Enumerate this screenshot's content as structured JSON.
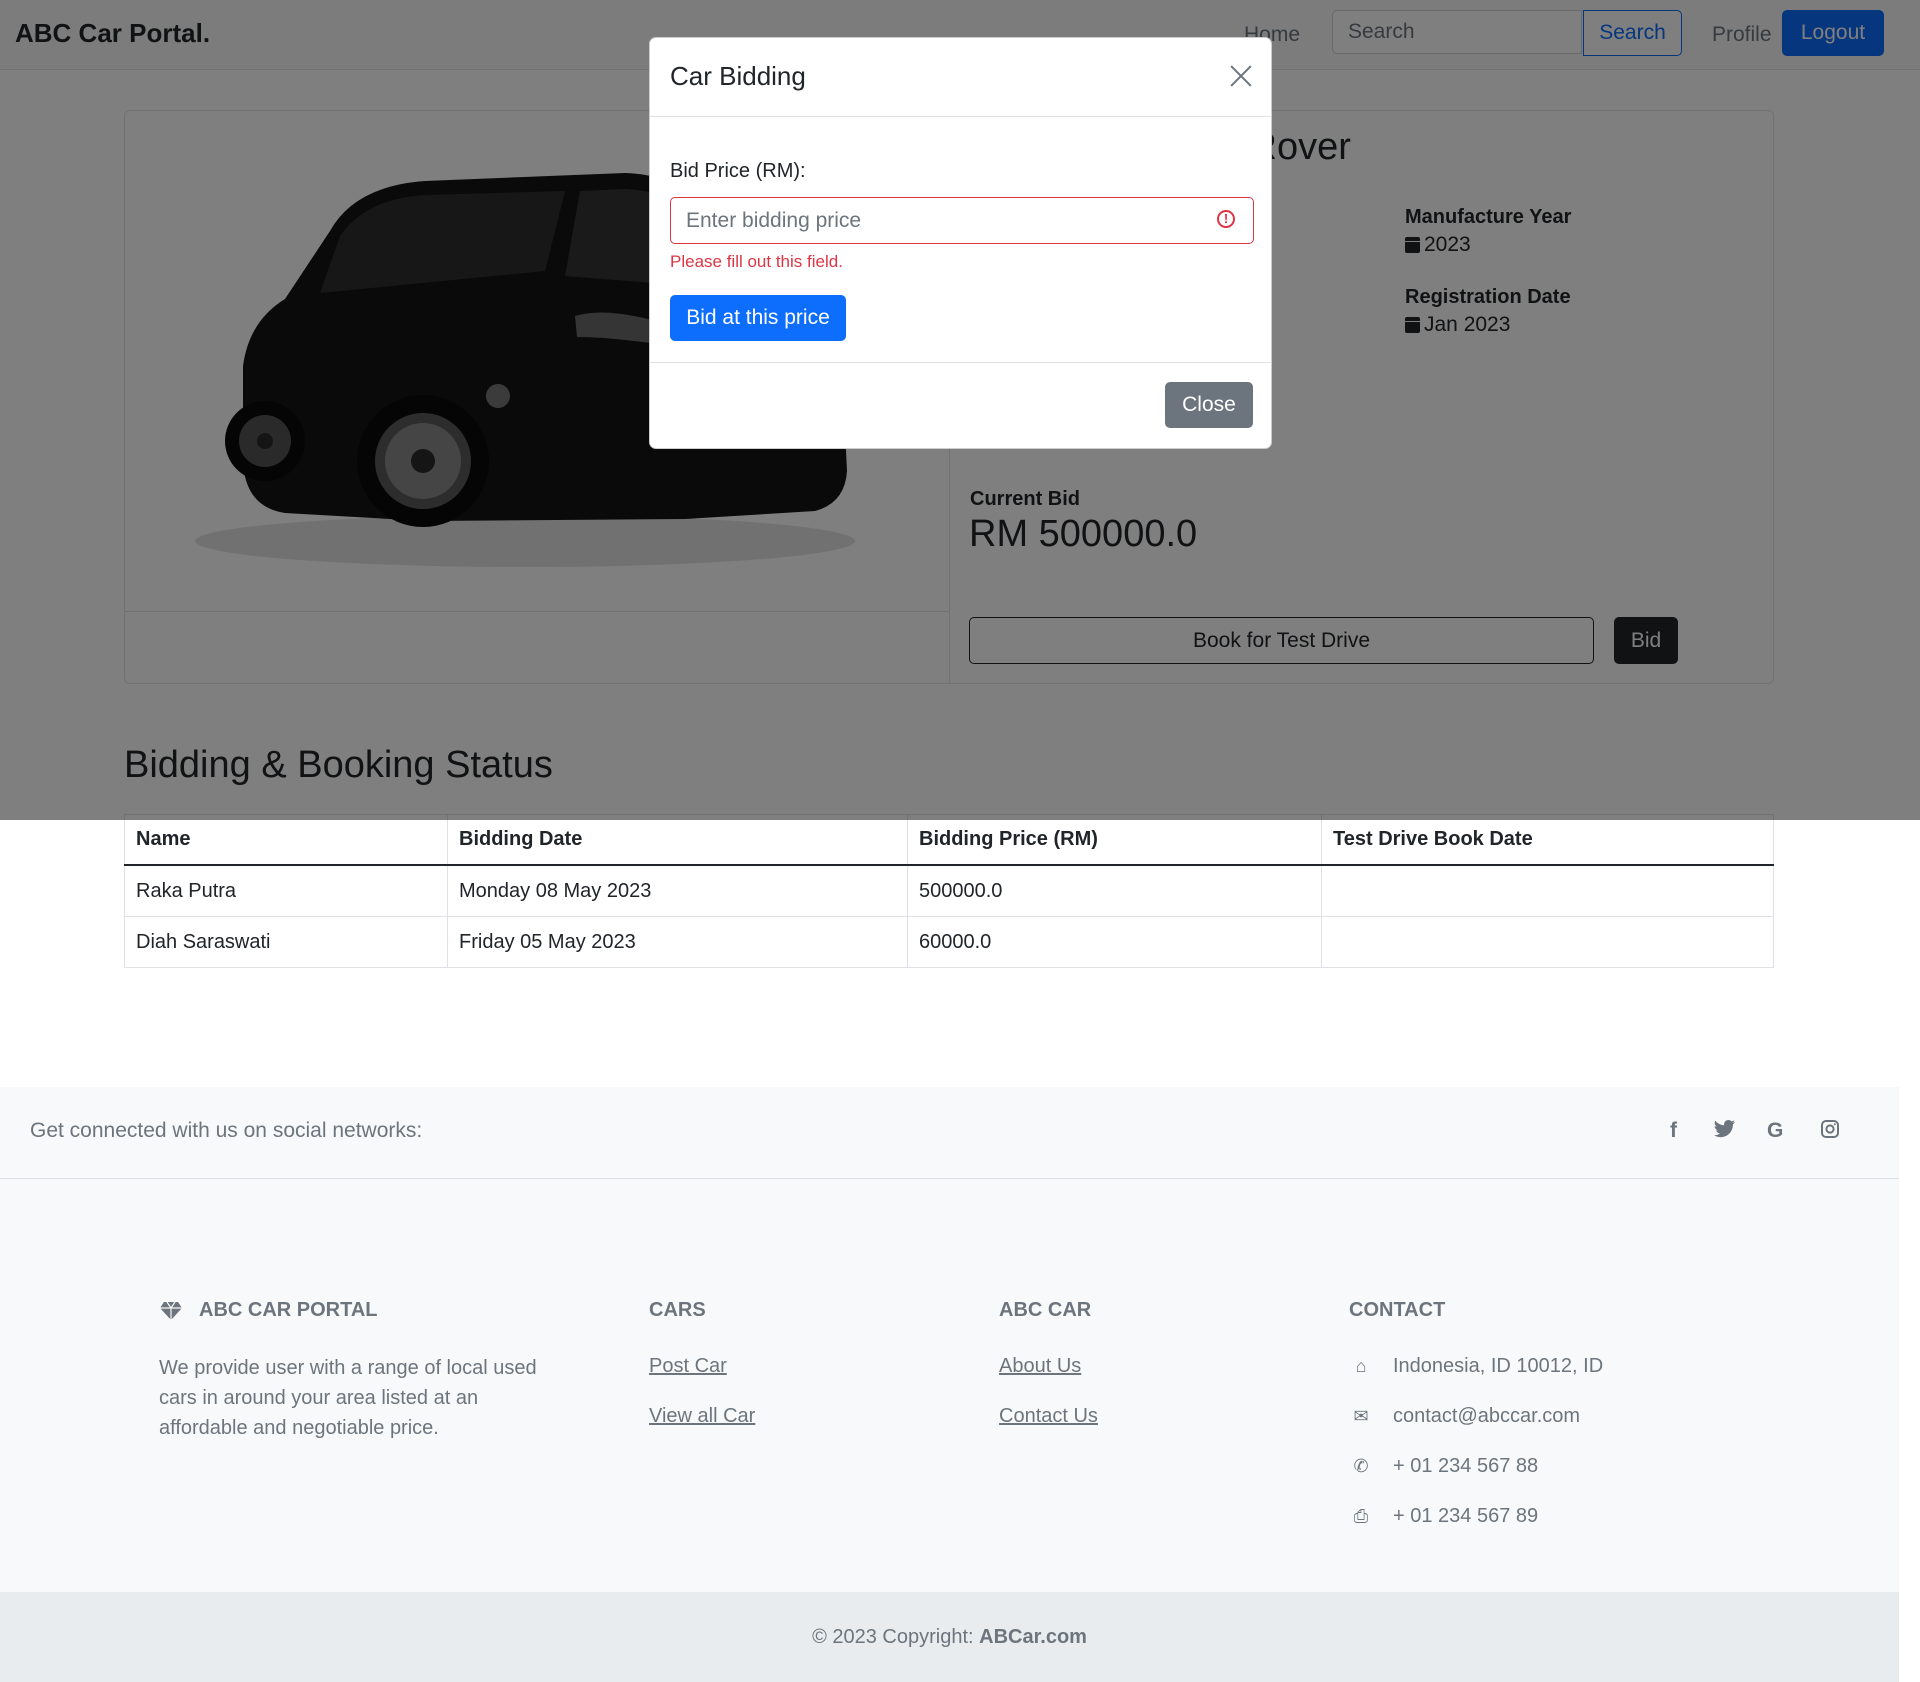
{
  "navbar": {
    "brand": "ABC Car Portal.",
    "home": "Home",
    "search_placeholder": "Search",
    "search_button": "Search",
    "profile": "Profile",
    "logout": "Logout"
  },
  "car": {
    "title_visible": "k Rover",
    "manufacture_year_label": "Manufacture Year",
    "manufacture_year": "2023",
    "registration_date_label": "Registration Date",
    "registration_date": "Jan 2023",
    "current_bid_label": "Current Bid",
    "current_bid": "RM 500000.0",
    "test_drive_button": "Book for Test Drive",
    "bid_button": "Bid"
  },
  "status": {
    "title": "Bidding & Booking Status",
    "columns": [
      "Name",
      "Bidding Date",
      "Bidding Price (RM)",
      "Test Drive Book Date"
    ],
    "rows": [
      [
        "Raka Putra",
        "Monday 08 May 2023",
        "500000.0",
        ""
      ],
      [
        "Diah Saraswati",
        "Friday 05 May 2023",
        "60000.0",
        ""
      ]
    ]
  },
  "modal": {
    "title": "Car Bidding",
    "bid_label": "Bid Price (RM):",
    "bid_placeholder": "Enter bidding price",
    "error": "Please fill out this field.",
    "submit": "Bid at this price",
    "close": "Close"
  },
  "footer": {
    "social_text": "Get connected with us on social networks:",
    "social_icons": [
      "facebook-icon",
      "twitter-icon",
      "google-icon",
      "instagram-icon"
    ],
    "brand_heading": "ABC CAR PORTAL",
    "description": "We provide user with a range of local used cars in around your area listed at an affordable and negotiable price.",
    "cars_heading": "CARS",
    "post_car": "Post Car",
    "view_all_car": "View all Car",
    "abc_heading": "ABC CAR",
    "about_us": "About Us",
    "contact_us": "Contact Us",
    "contact_heading": "CONTACT",
    "address": "Indonesia, ID 10012, ID",
    "email": "contact@abccar.com",
    "phone": "+ 01 234 567 88",
    "fax": "+ 01 234 567 89",
    "copyright_text": "© 2023 Copyright:",
    "copyright_link": "ABCar.com"
  },
  "colors": {
    "primary": "#0d6efd",
    "danger": "#dc3545",
    "secondary": "#6c757d",
    "dark": "#212529"
  }
}
